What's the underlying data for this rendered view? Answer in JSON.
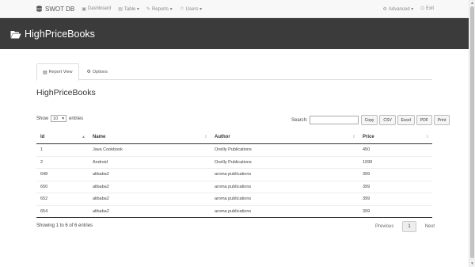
{
  "navbar": {
    "brand": "SWOT DB",
    "items": [
      {
        "icon": "dashboard-icon",
        "glyph": "▣",
        "label": "Dashboard"
      },
      {
        "icon": "table-icon",
        "glyph": "▤",
        "label": "Table ▾"
      },
      {
        "icon": "reports-icon",
        "glyph": "✎",
        "label": "Reports ▾"
      },
      {
        "icon": "user-icon",
        "glyph": "☺",
        "label": "Users ▾"
      }
    ],
    "right": [
      {
        "icon": "gear-icon",
        "glyph": "⚙",
        "label": "Advanced ▾"
      },
      {
        "icon": "exit-icon",
        "glyph": "⏻",
        "label": "Exit"
      }
    ]
  },
  "page_title": "HighPriceBooks",
  "tabs": [
    {
      "icon": "document-icon",
      "glyph": "▤",
      "label": "Report View",
      "active": true
    },
    {
      "icon": "gear-icon",
      "glyph": "⚙",
      "label": "Options",
      "active": false
    }
  ],
  "report_title": "HighPriceBooks",
  "controls": {
    "show_label": "Show",
    "entries_value": "10",
    "entries_label": "entries",
    "search_label": "Search:",
    "search_value": "",
    "buttons": [
      "Copy",
      "CSV",
      "Excel",
      "PDF",
      "Print"
    ]
  },
  "table": {
    "columns": [
      "Id",
      "Name",
      "Author",
      "Price"
    ],
    "rows": [
      [
        "1",
        "Java Cookbook",
        "Oreilly Publications",
        "450"
      ],
      [
        "2",
        "Android",
        "Oreilly Publications",
        "1099"
      ],
      [
        "648",
        "alibaba2",
        "aroma publications",
        "399"
      ],
      [
        "650",
        "alibaba2",
        "aroma publications",
        "399"
      ],
      [
        "652",
        "alibaba2",
        "aroma publications",
        "399"
      ],
      [
        "654",
        "alibaba2",
        "aroma publications",
        "399"
      ]
    ]
  },
  "footer": {
    "info": "Showing 1 to 6 of 6 entries",
    "previous": "Previous",
    "current_page": "1",
    "next": "Next"
  },
  "colors": {
    "title_band": "#3b3b3b",
    "navbar": "#f8f8f8",
    "sort_active": "#7b8bd0"
  }
}
